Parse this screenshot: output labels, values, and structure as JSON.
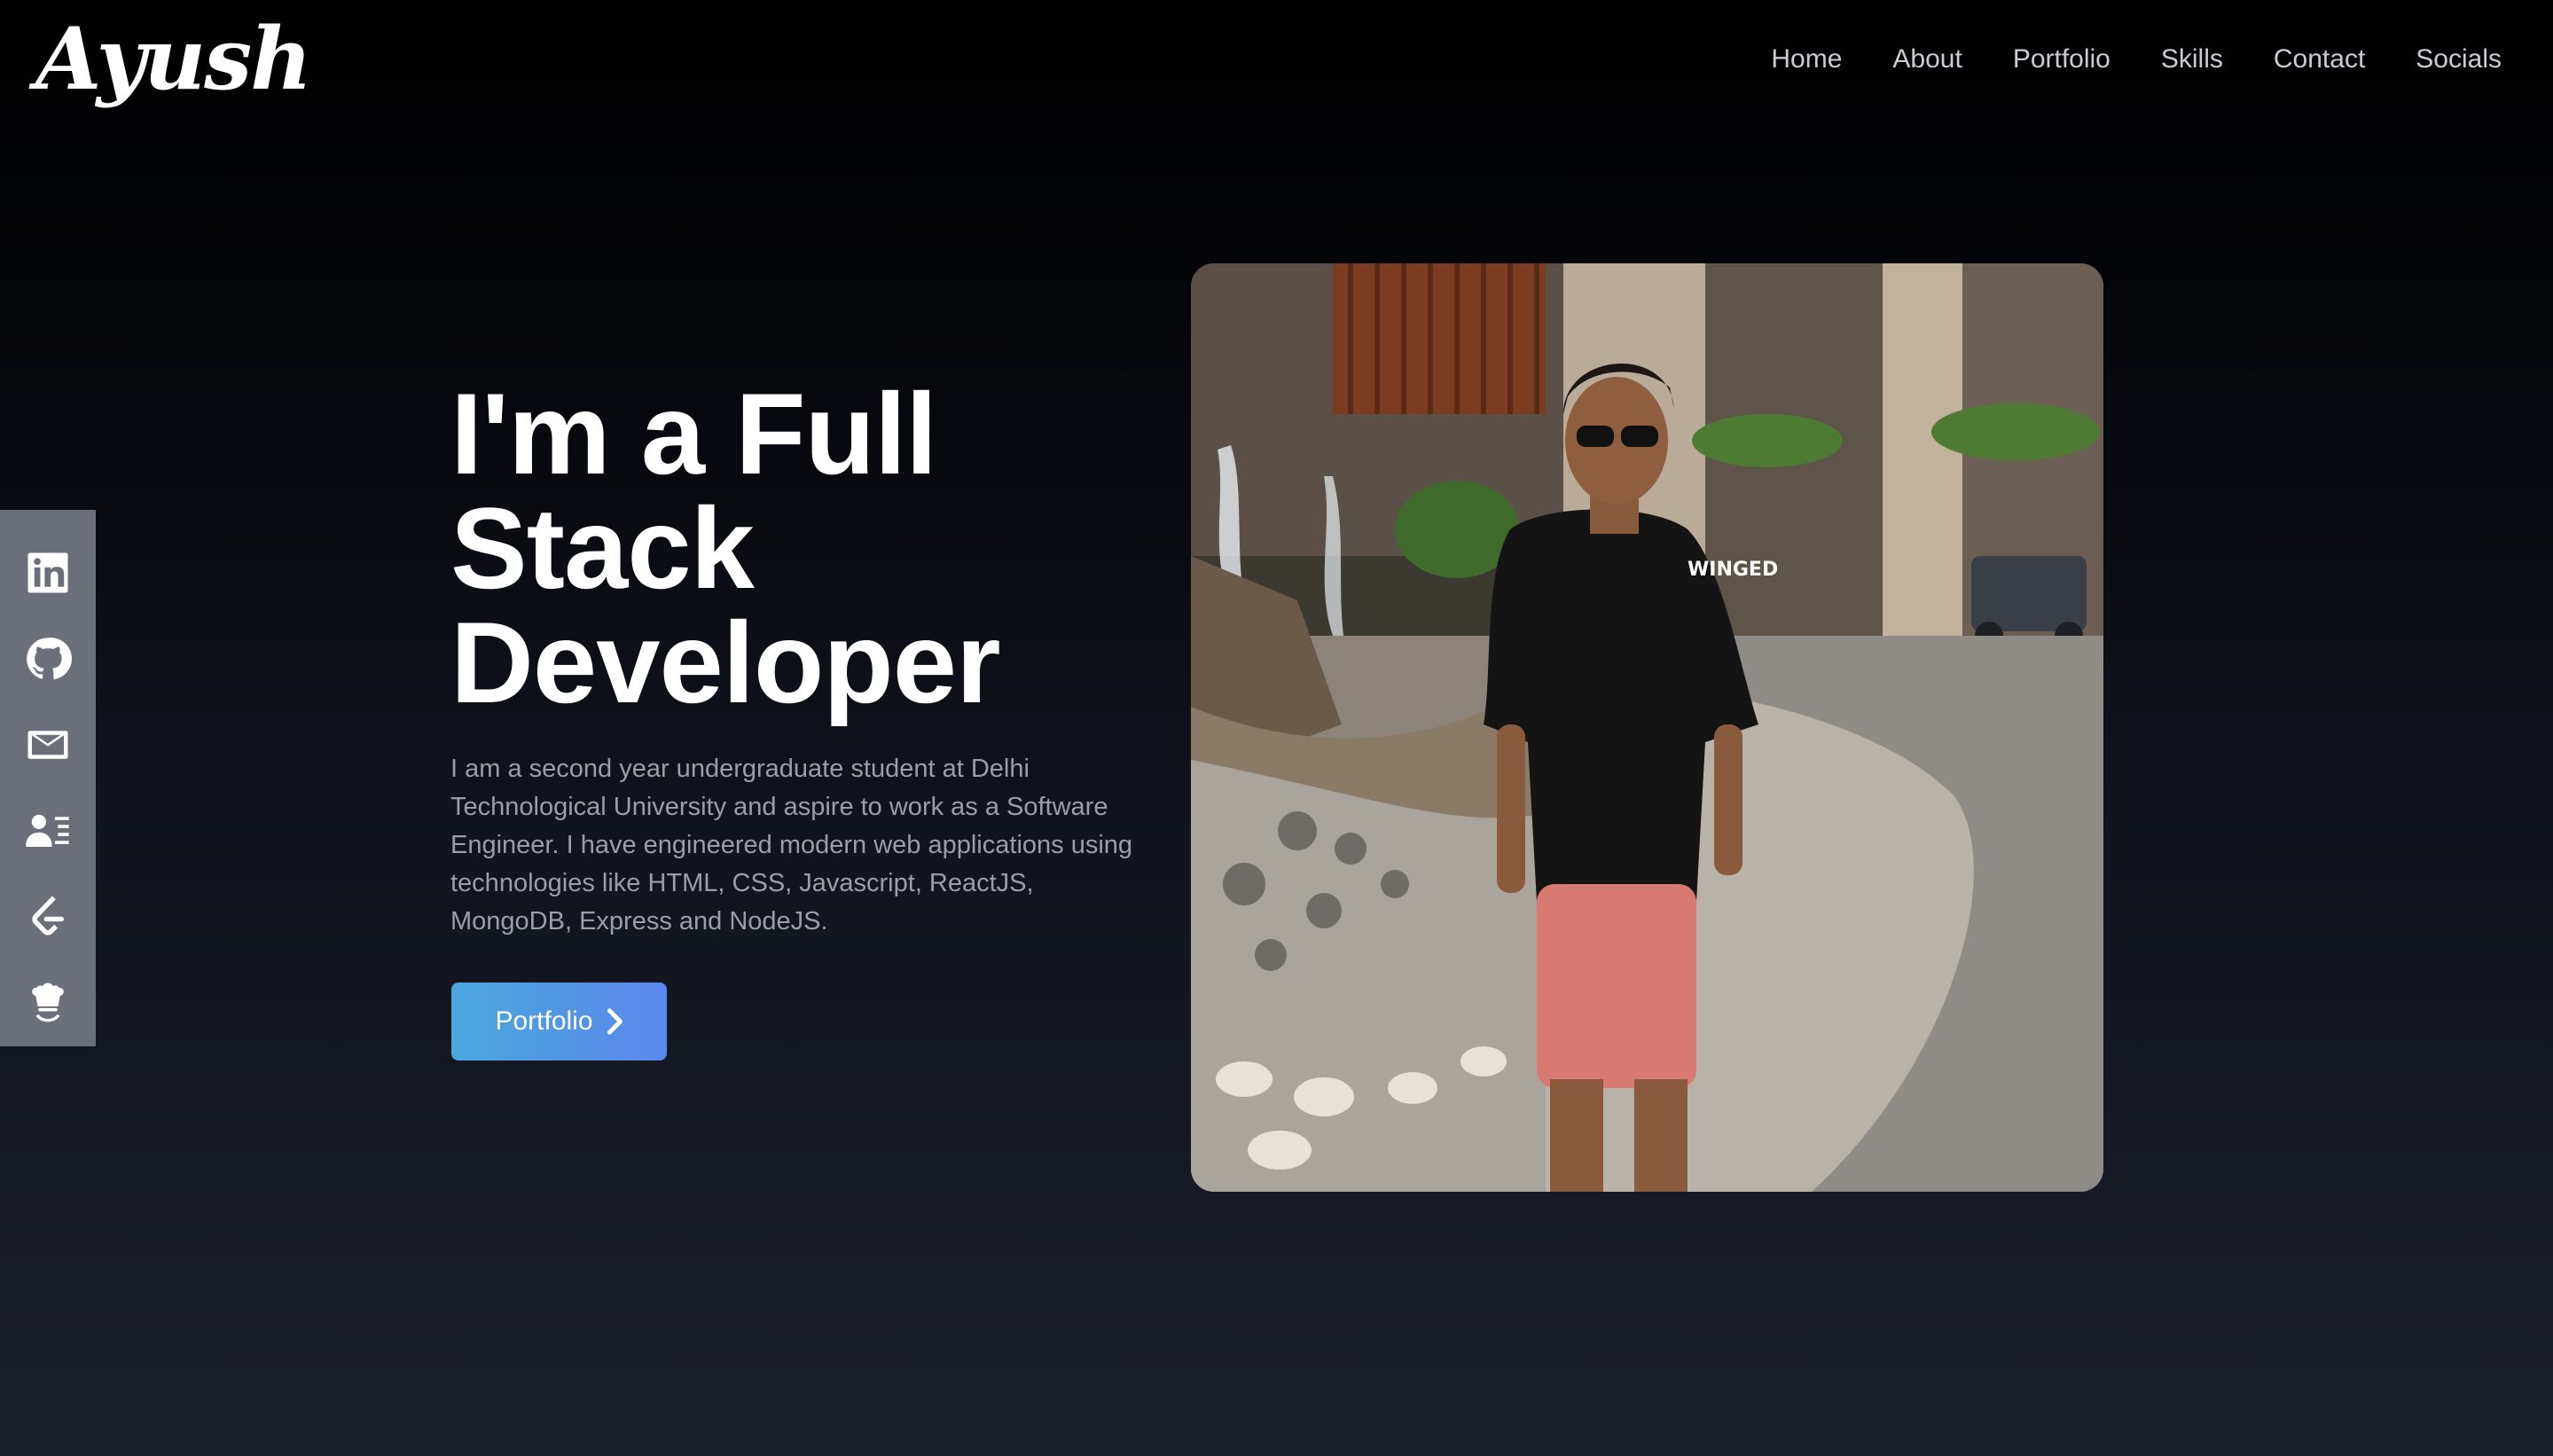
{
  "logo": {
    "text": "Ayush"
  },
  "nav": {
    "items": [
      "Home",
      "About",
      "Portfolio",
      "Skills",
      "Contact",
      "Socials"
    ]
  },
  "sidebar": {
    "items": [
      {
        "icon": "linkedin-icon"
      },
      {
        "icon": "github-icon"
      },
      {
        "icon": "mail-icon"
      },
      {
        "icon": "resume-icon"
      },
      {
        "icon": "leetcode-icon"
      },
      {
        "icon": "codechef-icon"
      }
    ]
  },
  "hero": {
    "title_line1": "I'm a Full",
    "title_line2": "Stack",
    "title_line3": "Developer",
    "description": "I am a second year undergraduate student at Delhi Technological University and aspire to work as a Software Engineer. I have engineered modern web applications using technologies like HTML, CSS, Javascript, ReactJS, MongoDB, Express and NodeJS.",
    "button_label": "Portfolio",
    "photo_shirt_text": "WINGED"
  },
  "colors": {
    "background_top": "#000000",
    "background_bottom": "#1b1f2b",
    "sidebar": "#6b6f79",
    "button_start": "#4aa8dc",
    "button_end": "#5b86ec",
    "nav_text": "#c9ccd3",
    "desc_text": "#9a9ea8"
  }
}
